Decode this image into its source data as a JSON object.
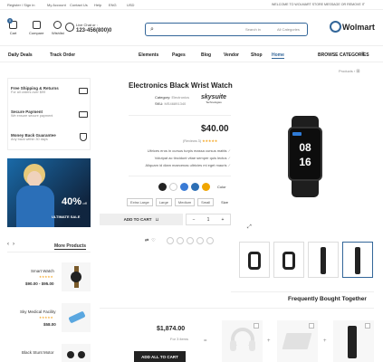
{
  "topbar": {
    "links": [
      "Register / Sign in",
      "My Account",
      "Contact Us",
      "Help",
      "ENG",
      "USD"
    ],
    "welcome": "WELCOME TO WOLMART STORE MESSAGE OR REMOVE IT"
  },
  "header": {
    "icons": [
      {
        "name": "cart-icon",
        "label": "Cart",
        "badge": "0"
      },
      {
        "name": "compare-icon",
        "label": "Compare"
      },
      {
        "name": "wishlist-icon",
        "label": "Wishlist"
      }
    ],
    "live_chat_label": "Live Chat or :",
    "phone": "123-456(800)0",
    "search_placeholder": "Search in",
    "category": "All Categories",
    "logo": "Wolmart"
  },
  "nav": {
    "left": [
      "Daily Deals",
      "Track Order"
    ],
    "items": [
      "Elements",
      "Pages",
      "Blog",
      "Vendor",
      "Shop",
      "Home"
    ],
    "browse": "BROWSE CATEGORIES"
  },
  "sidebar": {
    "features": [
      {
        "icon": "truck-icon",
        "title": "Free Shipping & Returns",
        "sub": "For all orders over $99"
      },
      {
        "icon": "card-icon",
        "title": "Secure Payment",
        "sub": "We ensure secure payment"
      },
      {
        "icon": "shield-icon",
        "title": "Money Back Guarantee",
        "sub": "Any back within 30 days"
      }
    ],
    "banner": {
      "big": "40%",
      "small": "off",
      "caption": "ULTIMATE SALE"
    },
    "more_products_title": "More Products",
    "products": [
      {
        "name": "Smart Watch",
        "price": "$90.00 - $95.00",
        "stars": "★★★★★"
      },
      {
        "name": "Sky Medical Facility",
        "price": "$58.00",
        "stars": "★★★★★"
      },
      {
        "name": "Black Stunt Motor",
        "price": "",
        "stars": ""
      }
    ]
  },
  "product": {
    "title": "Electronics Black Wrist Watch",
    "category_label": "Category:",
    "category": "Electronics",
    "sku_label": "SKU:",
    "sku": "MS46891340",
    "brand": "skysuite",
    "brand_sub": "Technologies",
    "price": "$40.00",
    "reviews": "(Reviews 3)",
    "features": [
      "Ultrices eros in cursus turpis massa cursus mattis",
      "Volutpat ac tincidunt vitae semper quis lectus",
      "Aliquam id diam maecenas ultricies mi eget mauris"
    ],
    "color_label": "Color",
    "colors": [
      "#222222",
      "#ffffff",
      "#3a7bd5",
      "#2d6fb5",
      "#f0a500"
    ],
    "size_label": "Size",
    "sizes": [
      "Extra Large",
      "Large",
      "Medium",
      "Small"
    ],
    "qty": "1",
    "add_to_cart": "ADD TO CART",
    "share_icons": [
      "facebook-icon",
      "twitter-icon",
      "pinterest-icon",
      "whatsapp-icon",
      "linkedin-icon"
    ],
    "watch_time_1": "08",
    "watch_time_2": "16"
  },
  "breadcrumb": {
    "parent": "Products",
    "sep": "›"
  },
  "fbt": {
    "title": "Frequently Bought Together",
    "price": "$1,874.00",
    "for_items": "For 3 items",
    "button": "ADD ALL TO CART"
  }
}
